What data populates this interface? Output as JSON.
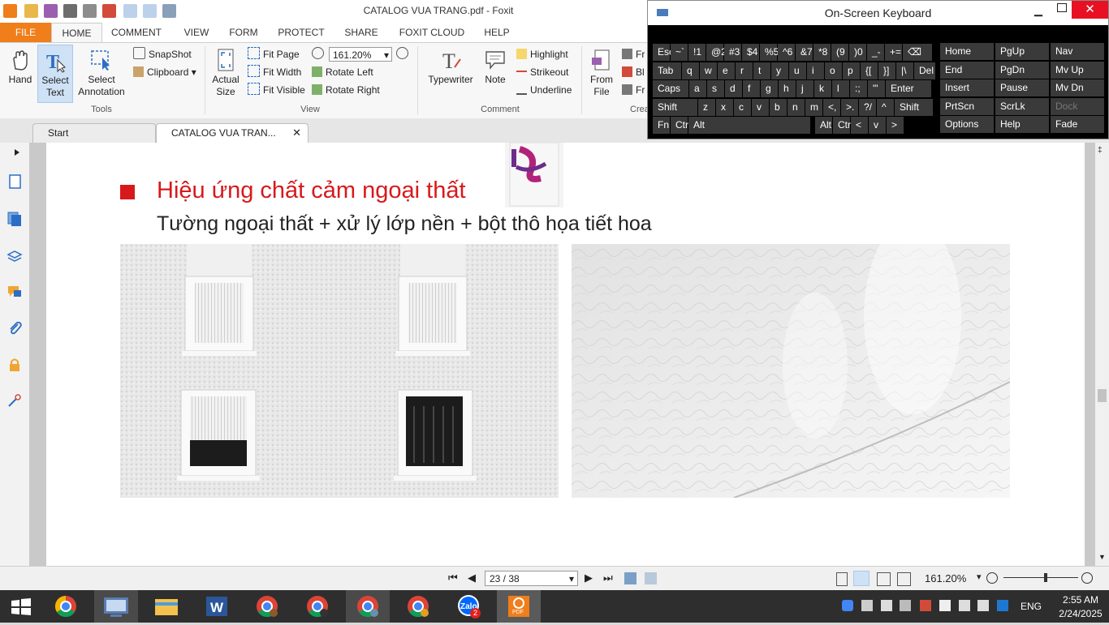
{
  "window": {
    "title": "CATALOG VUA TRANG.pdf - Foxit"
  },
  "menu_tabs": [
    "FILE",
    "HOME",
    "COMMENT",
    "VIEW",
    "FORM",
    "PROTECT",
    "SHARE",
    "FOXIT CLOUD",
    "HELP"
  ],
  "ribbon": {
    "tools": {
      "hand": "Hand",
      "select_text_1": "Select",
      "select_text_2": "Text",
      "select_annot_1": "Select",
      "select_annot_2": "Annotation",
      "snapshot": "SnapShot",
      "clipboard": "Clipboard",
      "group": "Tools"
    },
    "view": {
      "actual_1": "Actual",
      "actual_2": "Size",
      "fit_page": "Fit Page",
      "fit_width": "Fit Width",
      "fit_visible": "Fit Visible",
      "zoom": "161.20%",
      "rotate_left": "Rotate Left",
      "rotate_right": "Rotate Right",
      "group": "View"
    },
    "comment": {
      "typewriter": "Typewriter",
      "note": "Note",
      "highlight": "Highlight",
      "strikeout": "Strikeout",
      "underline": "Underline",
      "group": "Comment"
    },
    "create": {
      "from_file_1": "From",
      "from_file_2": "File",
      "fr1": "Fr",
      "bl": "Bl",
      "fr2": "Fr",
      "group": "Crea"
    }
  },
  "doc_tabs": [
    "Start",
    "CATALOG VUA TRAN..."
  ],
  "document": {
    "heading": "Hiệu ứng chất cảm ngoại thất",
    "subheading": "Tường ngoại thất + xử lý lớp nền + bột thô họa tiết hoa"
  },
  "statusbar": {
    "page": "23 / 38",
    "zoom": "161.20%"
  },
  "taskbar": {
    "zalo_badge": "2",
    "lang": "ENG",
    "time": "2:55 AM",
    "date": "2/24/2025"
  },
  "osk": {
    "title": "On-Screen Keyboard",
    "row1": [
      [
        "Esc",
        ""
      ],
      [
        "~`",
        ""
      ],
      [
        "!1",
        ""
      ],
      [
        "@2",
        ""
      ],
      [
        "#3",
        ""
      ],
      [
        "$4",
        ""
      ],
      [
        "%5",
        ""
      ],
      [
        "^6",
        ""
      ],
      [
        "&7",
        ""
      ],
      [
        "*8",
        ""
      ],
      [
        "(9",
        ""
      ],
      [
        ")0",
        ""
      ],
      [
        "_-",
        ""
      ],
      [
        "+=",
        ""
      ]
    ],
    "row2": [
      "Tab",
      "q",
      "w",
      "e",
      "r",
      "t",
      "y",
      "u",
      "i",
      "o",
      "p",
      "{[",
      "}]",
      "|\\",
      "Del"
    ],
    "row3": [
      "Caps",
      "a",
      "s",
      "d",
      "f",
      "g",
      "h",
      "j",
      "k",
      "l",
      ":;",
      "\"'",
      "Enter"
    ],
    "row4": [
      "Shift",
      "z",
      "x",
      "c",
      "v",
      "b",
      "n",
      "m",
      "<,",
      ">.",
      "?/",
      "^",
      "Shift"
    ],
    "row5": [
      "Fn",
      "Ctrl",
      "Alt",
      "Alt",
      "Ctrl",
      "<",
      "v",
      ">"
    ],
    "nav": [
      [
        "Home",
        "PgUp",
        "Nav"
      ],
      [
        "End",
        "PgDn",
        "Mv Up"
      ],
      [
        "Insert",
        "Pause",
        "Mv Dn"
      ],
      [
        "PrtScn",
        "ScrLk",
        "Dock"
      ],
      [
        "Options",
        "Help",
        "Fade"
      ]
    ]
  },
  "colors": {
    "file_tab": "#ef7e1b",
    "heading_red": "#d7191c",
    "taskbar": "#2e2e2e"
  }
}
